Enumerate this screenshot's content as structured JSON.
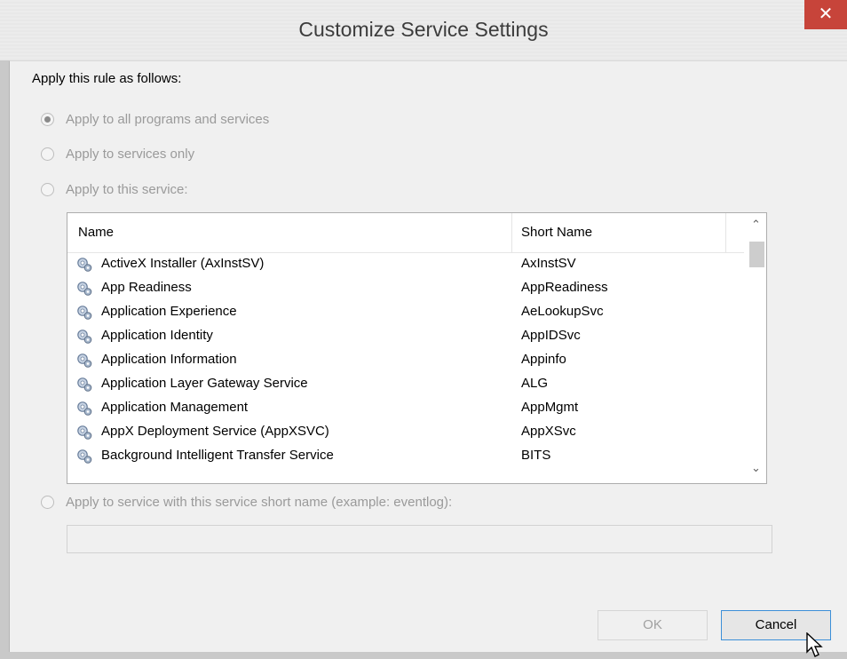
{
  "window": {
    "title": "Customize Service Settings",
    "close_glyph": "✕"
  },
  "section_label": "Apply this rule as follows:",
  "options": [
    {
      "label": "Apply to all programs and services",
      "checked": true
    },
    {
      "label": "Apply to services only",
      "checked": false
    },
    {
      "label": "Apply to this service:",
      "checked": false
    },
    {
      "label": "Apply to service with this service short name (example: eventlog):",
      "checked": false
    }
  ],
  "service_list": {
    "columns": [
      "Name",
      "Short Name"
    ],
    "rows": [
      {
        "name": "ActiveX Installer (AxInstSV)",
        "short": "AxInstSV"
      },
      {
        "name": "App Readiness",
        "short": "AppReadiness"
      },
      {
        "name": "Application Experience",
        "short": "AeLookupSvc"
      },
      {
        "name": "Application Identity",
        "short": "AppIDSvc"
      },
      {
        "name": "Application Information",
        "short": "Appinfo"
      },
      {
        "name": "Application Layer Gateway Service",
        "short": "ALG"
      },
      {
        "name": "Application Management",
        "short": "AppMgmt"
      },
      {
        "name": "AppX Deployment Service (AppXSVC)",
        "short": "AppXSvc"
      },
      {
        "name": "Background Intelligent Transfer Service",
        "short": "BITS"
      }
    ],
    "scroll_up_glyph": "⌃",
    "scroll_down_glyph": "⌄"
  },
  "short_name_input": {
    "value": ""
  },
  "buttons": {
    "ok": "OK",
    "cancel": "Cancel"
  },
  "colors": {
    "close_button": "#c7443a",
    "cancel_focus_border": "#3c8fd8"
  },
  "icons": {
    "row_icon": "service-gear-icon",
    "cursor": "mouse-pointer-icon"
  }
}
